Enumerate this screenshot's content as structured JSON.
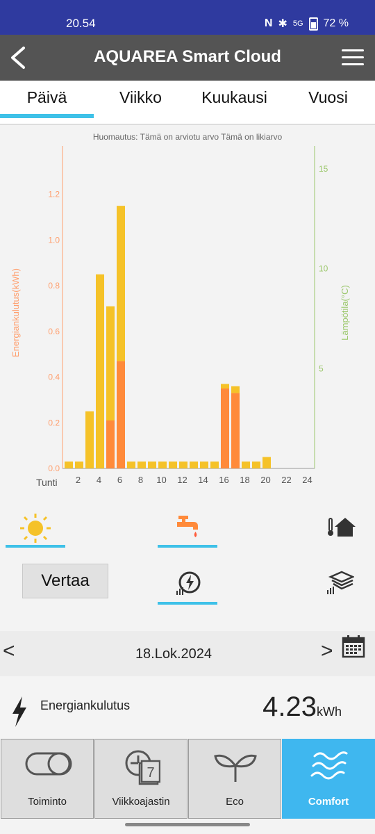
{
  "status": {
    "time": "20.54",
    "battery": "72 %",
    "network": "5G"
  },
  "app": {
    "title": "AQUAREA Smart Cloud"
  },
  "tabs": [
    {
      "label": "Päivä",
      "active": true
    },
    {
      "label": "Viikko"
    },
    {
      "label": "Kuukausi"
    },
    {
      "label": "Vuosi"
    }
  ],
  "note": "Huomautus: Tämä on arviotu arvo Tämä on likiarvo",
  "chart_data": {
    "type": "bar",
    "stacked": true,
    "title": "",
    "xlabel": "Tunti",
    "ylabel": "Energiankulutus(kWh)",
    "y2label": "Lämpötila(°C)",
    "ylim": [
      0,
      1.4
    ],
    "y2lim": [
      0,
      16
    ],
    "yticks": [
      "0.0",
      "0.2",
      "0.4",
      "0.6",
      "0.8",
      "1.0",
      "1.2"
    ],
    "y2ticks": [
      "5",
      "10",
      "15"
    ],
    "xticks": [
      "2",
      "4",
      "6",
      "8",
      "10",
      "12",
      "14",
      "16",
      "18",
      "20",
      "22",
      "24"
    ],
    "categories": [
      1,
      2,
      3,
      4,
      5,
      6,
      7,
      8,
      9,
      10,
      11,
      12,
      13,
      14,
      15,
      16,
      17,
      18,
      19,
      20,
      21,
      22,
      23,
      24
    ],
    "series": [
      {
        "color": "#ff8a3a",
        "values": [
          0,
          0,
          0,
          0,
          0.21,
          0.47,
          0,
          0,
          0,
          0,
          0,
          0,
          0,
          0,
          0,
          0.35,
          0.33,
          0,
          0,
          0,
          0,
          0,
          0,
          0
        ]
      },
      {
        "color": "#f5c228",
        "values": [
          0.03,
          0.03,
          0.25,
          0.85,
          0.5,
          0.68,
          0.03,
          0.03,
          0.03,
          0.03,
          0.03,
          0.03,
          0.03,
          0.03,
          0.03,
          0.02,
          0.03,
          0.03,
          0.03,
          0.05,
          0,
          0,
          0,
          0
        ]
      }
    ],
    "grid": false,
    "colors": {
      "left_axis": "#ff9f6e",
      "right_axis": "#9bc76b"
    }
  },
  "mode_icons": {
    "sun": "sun-icon",
    "tap": "tap-water-icon",
    "house": "house-temperature-icon",
    "energy": "energy-consumption-icon",
    "layers": "layers-icon"
  },
  "compare_button": "Vertaa",
  "date": {
    "value": "18.Lok.2024",
    "prev": "<",
    "next": ">"
  },
  "energy": {
    "label": "Energiankulutus",
    "value": "4.23",
    "unit": "kWh"
  },
  "bottom_nav": [
    {
      "label": "Toiminto",
      "icon": "toggle-icon"
    },
    {
      "label": "Viikkoajastin",
      "icon": "weekly-timer-icon"
    },
    {
      "label": "Eco",
      "icon": "leaf-icon"
    },
    {
      "label": "Comfort",
      "icon": "wave-icon",
      "active": true
    }
  ],
  "colors": {
    "accent": "#3ec1e8",
    "active_nav": "#3fb7ef",
    "header": "#545454",
    "statusbar": "#2f3a9f"
  }
}
